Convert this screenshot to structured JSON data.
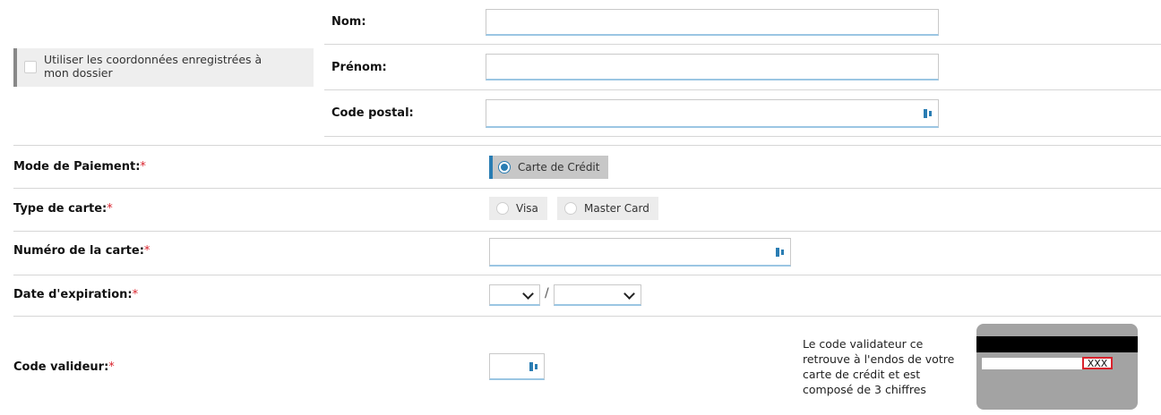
{
  "saved_info": {
    "label": "Utiliser les coordonnées enregistrées à mon dossier",
    "checked": false
  },
  "identity": {
    "nom_label": "Nom:",
    "nom_value": "",
    "prenom_label": "Prénom:",
    "prenom_value": "",
    "code_postal_label": "Code postal:",
    "code_postal_value": ""
  },
  "payment": {
    "mode_label": "Mode de Paiement:",
    "required_mark": "*",
    "mode_option": "Carte de Crédit",
    "mode_selected": true,
    "card_type_label": "Type de carte:",
    "card_types": [
      "Visa",
      "Master Card"
    ],
    "card_number_label": "Numéro de la carte:",
    "card_number_value": "",
    "expiration_label": "Date d'expiration:",
    "expiration_separator": "/",
    "expiration_month": "",
    "expiration_year": "",
    "cvv_label": "Code valideur:",
    "cvv_value": "",
    "cvv_help": "Le code validateur ce retrouve à l'endos de votre carte de crédit et est composé de 3 chiffres",
    "cvv_example": "XXX"
  },
  "colors": {
    "accent": "#2a7db3",
    "required": "#d9232d",
    "card_grey": "#a3a3a3",
    "cvv_box": "#d9232d"
  }
}
